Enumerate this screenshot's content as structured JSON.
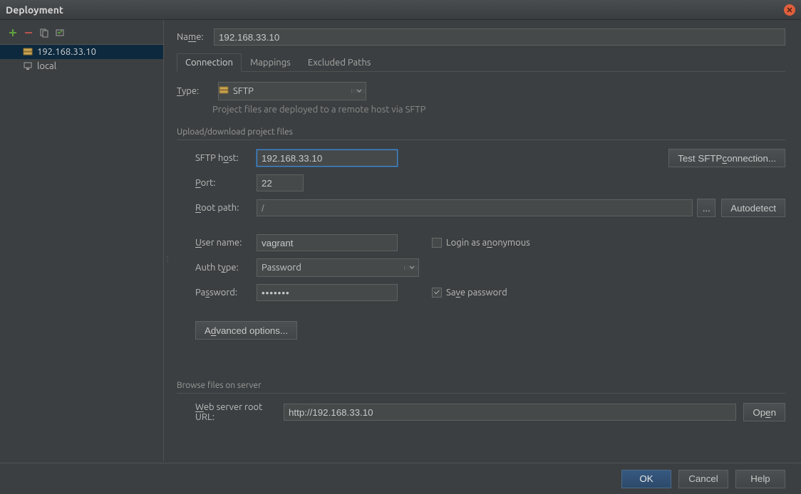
{
  "window": {
    "title": "Deployment"
  },
  "sidebar": {
    "items": [
      {
        "label": "192.168.33.10",
        "selected": true,
        "type": "sftp"
      },
      {
        "label": "local",
        "selected": false,
        "type": "local"
      }
    ]
  },
  "form": {
    "name_label": "Name:",
    "name_value": "192.168.33.10",
    "tabs": [
      {
        "label": "Connection",
        "active": true
      },
      {
        "label": "Mappings",
        "active": false
      },
      {
        "label": "Excluded Paths",
        "active": false
      }
    ],
    "type_label": "Type:",
    "type_value": "SFTP",
    "type_description": "Project files are deployed to a remote host via SFTP",
    "section_upload": "Upload/download project files",
    "host_label": "SFTP host:",
    "host_value": "192.168.33.10",
    "test_connection": "Test SFTP connection...",
    "port_label": "Port:",
    "port_value": "22",
    "root_label": "Root path:",
    "root_value": "/",
    "browse_ellipsis": "...",
    "autodetect": "Autodetect",
    "user_label": "User name:",
    "user_value": "vagrant",
    "anon_label": "Login as anonymous",
    "anon_checked": false,
    "auth_label": "Auth type:",
    "auth_value": "Password",
    "pass_label": "Password:",
    "pass_value": "•••••••",
    "save_pass_label": "Save password",
    "save_pass_checked": true,
    "advanced": "Advanced options...",
    "section_browse": "Browse files on server",
    "web_label": "Web server root URL:",
    "web_value": "http://192.168.33.10",
    "open": "Open"
  },
  "buttons": {
    "ok": "OK",
    "cancel": "Cancel",
    "help": "Help"
  }
}
